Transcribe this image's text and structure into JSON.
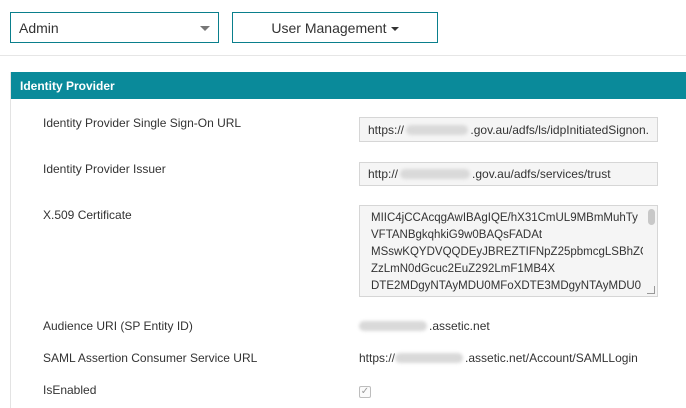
{
  "topbar": {
    "role_select": {
      "value": "Admin"
    },
    "menu_button": {
      "label": "User Management"
    }
  },
  "panel": {
    "title": "Identity Provider",
    "fields": {
      "sso_url": {
        "label": "Identity Provider Single Sign-On URL",
        "prefix": "https://",
        "suffix": ".gov.au/adfs/ls/idpInitiatedSignon."
      },
      "issuer": {
        "label": "Identity Provider Issuer",
        "prefix": "http://",
        "suffix": ".gov.au/adfs/services/trust"
      },
      "certificate": {
        "label": "X.509 Certificate",
        "lines": [
          "MIIC4jCCAcqgAwIBAgIQE/hX31CmUL9MBmMuhTy",
          "VFTANBgkqhkiG9w0BAQsFADAt",
          "MSswKQYDVQQDEyJBREZTIFNpZ25pbmcgLSBhZG",
          "ZzLmN0dGcuc2EuZ292LmF1MB4X",
          "DTE2MDgyNTAyMDU0MFoXDTE3MDgyNTAyMDU0"
        ]
      },
      "audience_uri": {
        "label": "Audience URI (SP Entity ID)",
        "suffix": ".assetic.net"
      },
      "acs_url": {
        "label": "SAML Assertion Consumer Service URL",
        "prefix": "https://",
        "suffix": ".assetic.net/Account/SAMLLogin"
      },
      "is_enabled": {
        "label": "IsEnabled",
        "checked": true,
        "glyph": "✓"
      }
    }
  },
  "colors": {
    "accent": "#0a8a9a",
    "border_accent": "#0a7f8c"
  }
}
